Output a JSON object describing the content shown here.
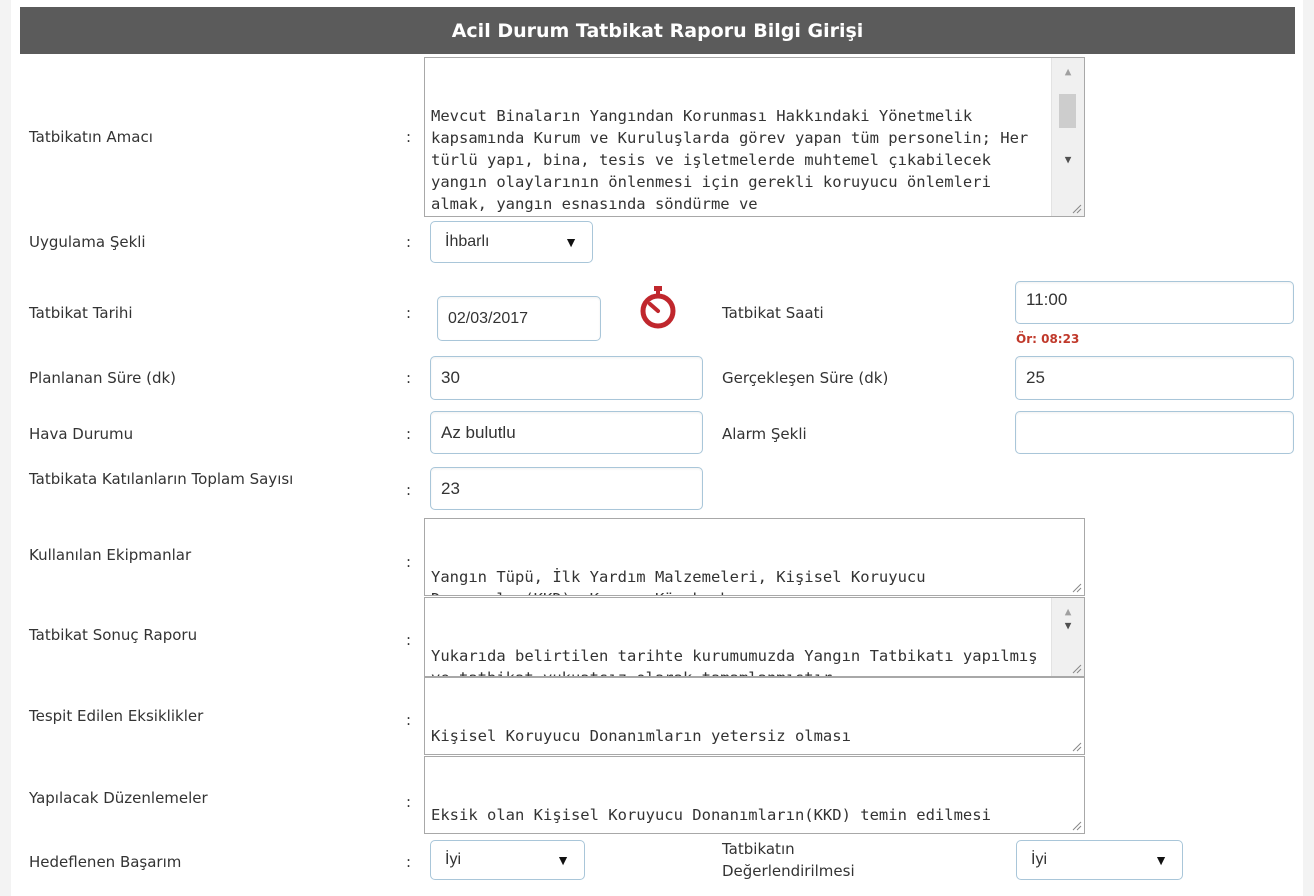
{
  "form": {
    "title": "Acil Durum Tatbikat Raporu Bilgi Girişi",
    "colon": ":",
    "purpose": {
      "label": "Tatbikatın Amacı",
      "value": "Mevcut Binaların Yangından Korunması Hakkındaki Yönetmelik kapsamında Kurum ve Kuruluşlarda görev yapan tüm personelin; Her türlü yapı, bina, tesis ve işletmelerde muhtemel çıkabilecek yangın olaylarının önlenmesi için gerekli koruyucu önlemleri almak, yangın esnasında söndürme ve"
    },
    "application": {
      "label": "Uygulama Şekli",
      "value": "İhbarlı"
    },
    "drill_date": {
      "label": "Tatbikat Tarihi",
      "value": "02/03/2017"
    },
    "drill_time": {
      "label": "Tatbikat Saati",
      "value": "11:00",
      "hint": "Ör: 08:23"
    },
    "planned_duration": {
      "label": "Planlanan Süre (dk)",
      "value": "30"
    },
    "actual_duration": {
      "label": "Gerçekleşen Süre (dk)",
      "value": "25"
    },
    "weather": {
      "label": "Hava Durumu",
      "value": "Az bulutlu"
    },
    "alarm_type": {
      "label": "Alarm Şekli",
      "value": ""
    },
    "participants": {
      "label": "Tatbikata Katılanların Toplam Sayısı",
      "value": "23"
    },
    "equipment": {
      "label": "Kullanılan Ekipmanlar",
      "value": "Yangın Tüpü, İlk Yardım Malzemeleri, Kişisel Koruyucu Donanımlar(KKD), Kazma, Kürek vb."
    },
    "result_report": {
      "label": "Tatbikat Sonuç Raporu",
      "value": "Yukarıda belirtilen tarihte kurumumuzda Yangın Tatbikatı yapılmış ve tatbikat vukuatsız olarak tamamlanmıştır."
    },
    "deficiencies": {
      "label": "Tespit Edilen Eksiklikler",
      "value": "Kişisel Koruyucu Donanımların yetersiz olması"
    },
    "arrangements": {
      "label": "Yapılacak Düzenlemeler",
      "value": "Eksik olan Kişisel Koruyucu Donanımların(KKD) temin edilmesi"
    },
    "target_performance": {
      "label": "Hedeflenen Başarım",
      "value": "İyi"
    },
    "evaluation": {
      "label": "Tatbikatın Değerlendirilmesi",
      "value": "İyi"
    }
  },
  "icons": {
    "stopwatch": "stopwatch-icon",
    "dropdown": "chevron-down-icon"
  },
  "colors": {
    "header_bg": "#5b5b5b",
    "hint": "#c0392b",
    "stopwatch": "#c0272d",
    "input_border": "#a9c6d9"
  }
}
